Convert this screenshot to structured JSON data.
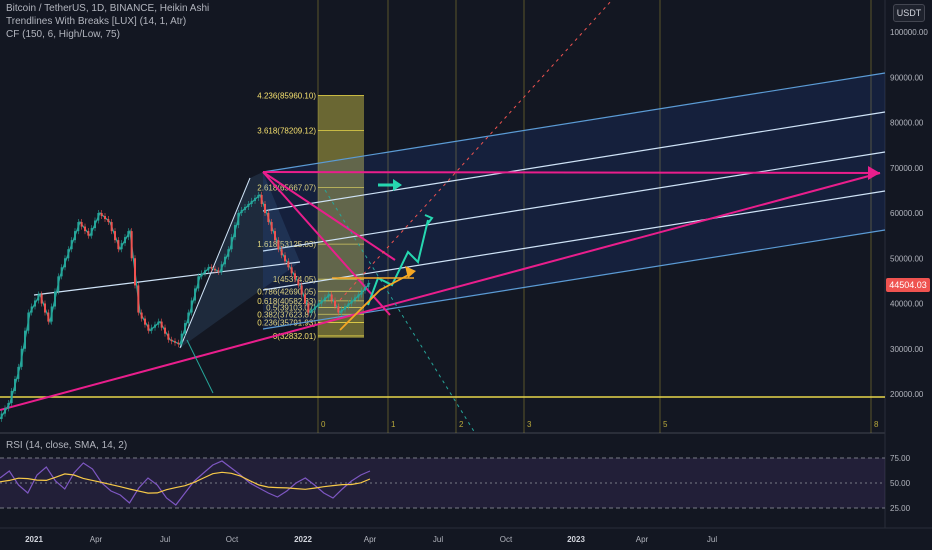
{
  "header": {
    "symbol": "Bitcoin / TetherUS, 1D, BINANCE, Heikin Ashi",
    "indicator_1": "Trendlines With Breaks [LUX] (14, 1, Atr)",
    "indicator_2": "CF (150, 6, High/Low, 75)",
    "currency_button": "USDT"
  },
  "rsi_legend": "RSI (14, close, SMA, 14, 2)",
  "last_price": "44504.03",
  "chart_data": [
    {
      "type": "line",
      "title": "Bitcoin / TetherUS, 1D, BINANCE, Heikin Ashi",
      "x_ticks": [
        "2021",
        "Apr",
        "Jul",
        "Oct",
        "2022",
        "Apr",
        "Jul",
        "Oct",
        "2023",
        "Apr",
        "Jul"
      ],
      "y_ticks": [
        "100000.00",
        "90000.00",
        "80000.00",
        "70000.00",
        "60000.00",
        "50000.00",
        "40000.00",
        "30000.00",
        "20000.00"
      ],
      "price_path": [
        [
          0,
          14500
        ],
        [
          10,
          18000
        ],
        [
          20,
          26000
        ],
        [
          30,
          38000
        ],
        [
          40,
          42000
        ],
        [
          50,
          36000
        ],
        [
          60,
          46000
        ],
        [
          70,
          52000
        ],
        [
          80,
          58000
        ],
        [
          90,
          55000
        ],
        [
          100,
          60000
        ],
        [
          110,
          58000
        ],
        [
          120,
          52000
        ],
        [
          130,
          56000
        ],
        [
          140,
          38000
        ],
        [
          150,
          34000
        ],
        [
          160,
          36000
        ],
        [
          170,
          32000
        ],
        [
          180,
          31000
        ],
        [
          190,
          38000
        ],
        [
          200,
          46000
        ],
        [
          210,
          48000
        ],
        [
          220,
          47000
        ],
        [
          230,
          52000
        ],
        [
          240,
          60000
        ],
        [
          250,
          62000
        ],
        [
          260,
          64000
        ],
        [
          270,
          58000
        ],
        [
          280,
          52000
        ],
        [
          290,
          48000
        ],
        [
          300,
          44000
        ],
        [
          310,
          38000
        ],
        [
          320,
          40000
        ],
        [
          330,
          42000
        ],
        [
          340,
          38000
        ],
        [
          350,
          40000
        ],
        [
          360,
          42000
        ],
        [
          370,
          44504
        ]
      ],
      "fibonacci_levels": [
        {
          "label": "4.236(85960.10)",
          "value": 85960.1
        },
        {
          "label": "3.618(78209.12)",
          "value": 78209.12
        },
        {
          "label": "2.618(65667.07)",
          "value": 65667.07
        },
        {
          "label": "1.618(53125.03)",
          "value": 53125.03
        },
        {
          "label": "1(45374.05)",
          "value": 45374.05
        },
        {
          "label": "0.786(42690.05)",
          "value": 42690.05
        },
        {
          "label": "0.618(40582.33)",
          "value": 40582.33
        },
        {
          "label": "0.5(39103.07)",
          "value": 39103.07
        },
        {
          "label": "0.382(37623.87)",
          "value": 37623.87
        },
        {
          "label": "0.236(35791.93)",
          "value": 35791.93
        },
        {
          "label": "0(32832.01)",
          "value": 32832.01
        }
      ],
      "fib_time_labels": [
        "0",
        "1",
        "2",
        "3",
        "5",
        "8"
      ],
      "horizontal_support": 19500,
      "last_price": 44504.03,
      "ylim": [
        12000,
        104000
      ]
    },
    {
      "type": "line",
      "title": "RSI (14, close, SMA, 14, 2)",
      "y_ticks": [
        "75.00",
        "50.00",
        "25.00"
      ],
      "band": [
        30,
        70
      ],
      "rsi": [
        55,
        62,
        48,
        40,
        58,
        66,
        52,
        44,
        60,
        70,
        64,
        50,
        42,
        38,
        30,
        45,
        55,
        48,
        35,
        28,
        40,
        52,
        60,
        68,
        72,
        65,
        58,
        50,
        45,
        40,
        36,
        42,
        50,
        55,
        48,
        40,
        35,
        44,
        52,
        58,
        62
      ]
    }
  ]
}
